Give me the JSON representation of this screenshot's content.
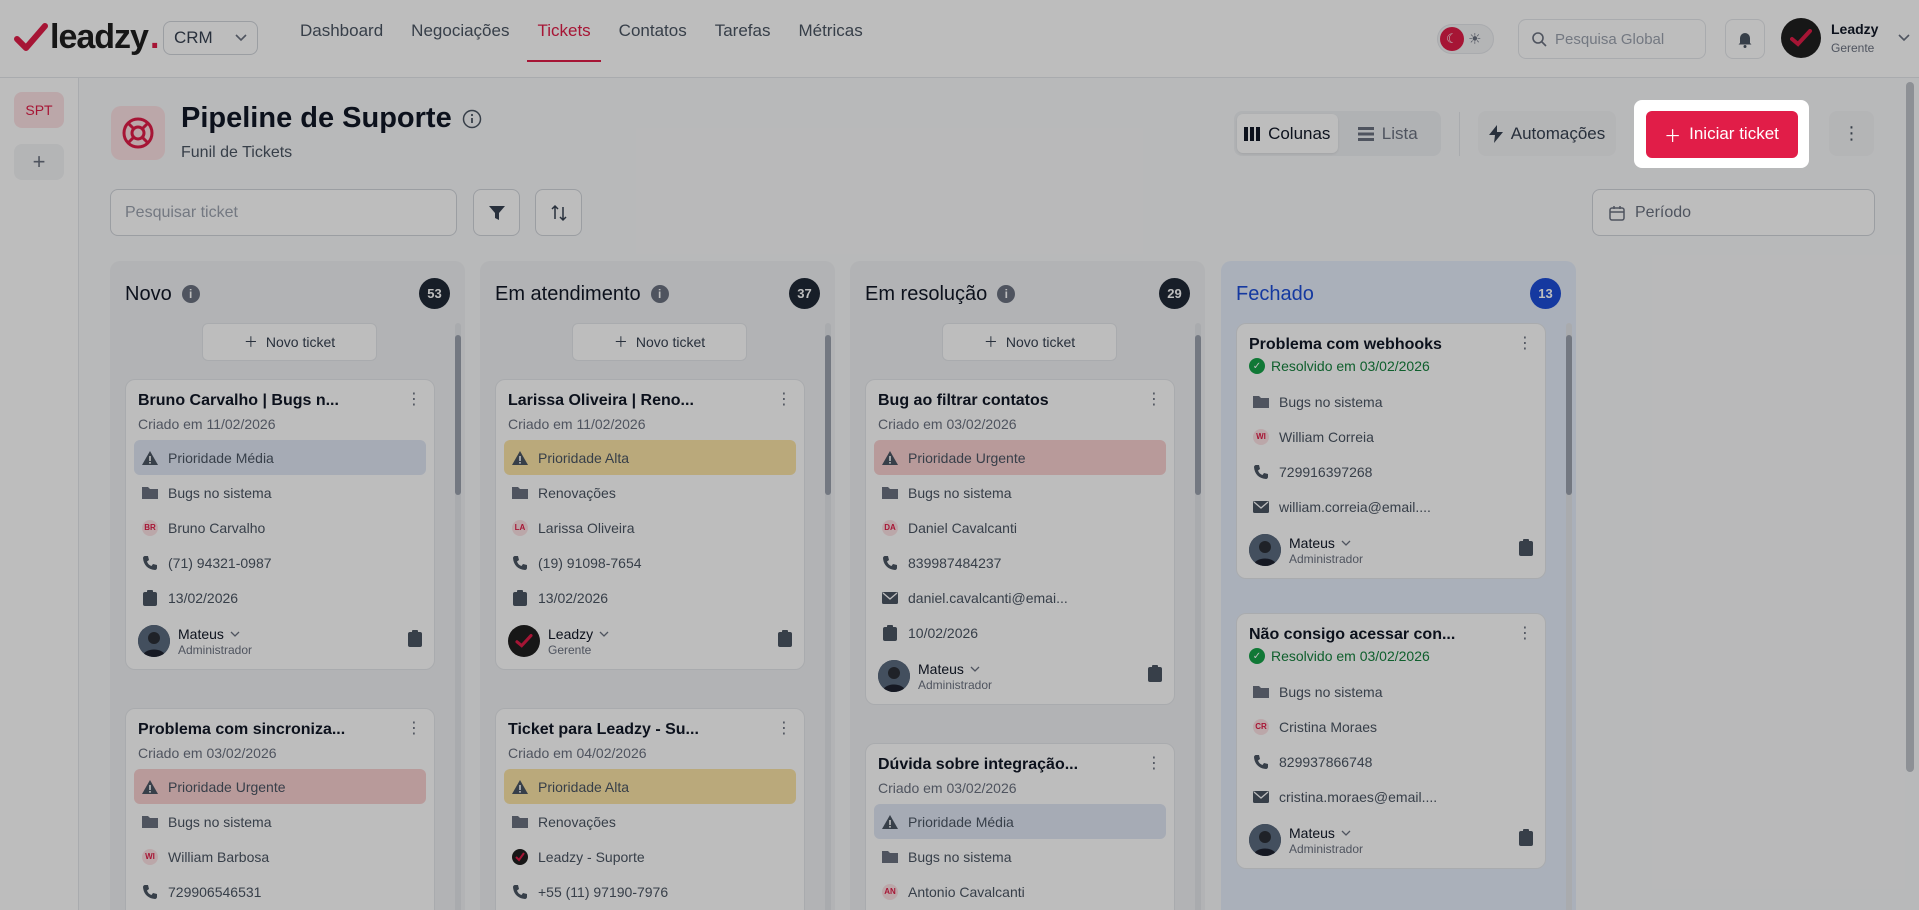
{
  "topbar": {
    "logo_text": "leadzy",
    "logo_dot": ".",
    "module_select": "CRM",
    "nav": [
      "Dashboard",
      "Negociações",
      "Tickets",
      "Contatos",
      "Tarefas",
      "Métricas"
    ],
    "active_nav": "Tickets",
    "search_placeholder": "Pesquisa Global",
    "user": {
      "name": "Leadzy",
      "role": "Gerente"
    }
  },
  "rail": {
    "pipeline_tag": "SPT",
    "add": "+"
  },
  "header": {
    "title": "Pipeline de Suporte",
    "subtitle": "Funil de Tickets",
    "view_columns": "Colunas",
    "view_list": "Lista",
    "automations": "Automações",
    "start_ticket": "Iniciar ticket",
    "search_placeholder": "Pesquisar ticket",
    "period": "Período"
  },
  "new_ticket_label": "Novo ticket",
  "columns": [
    {
      "title": "Novo",
      "count": "53",
      "cards": [
        {
          "title": "Bruno Carvalho | Bugs n...",
          "date": "Criado em 11/02/2026",
          "priority": "Prioridade Média",
          "category": "Bugs no sistema",
          "initials": "BR",
          "contact": "Bruno Carvalho",
          "phone": "(71) 94321-0987",
          "due": "13/02/2026",
          "assignee": "Mateus",
          "assignee_role": "Administrador"
        },
        {
          "title": "Problema com sincroniza...",
          "date": "Criado em 03/02/2026",
          "priority": "Prioridade Urgente",
          "category": "Bugs no sistema",
          "initials": "WI",
          "contact": "William Barbosa",
          "phone": "729906546531"
        }
      ]
    },
    {
      "title": "Em atendimento",
      "count": "37",
      "cards": [
        {
          "title": "Larissa Oliveira | Reno...",
          "date": "Criado em 11/02/2026",
          "priority": "Prioridade Alta",
          "category": "Renovações",
          "initials": "LA",
          "contact": "Larissa Oliveira",
          "phone": "(19) 91098-7654",
          "due": "13/02/2026",
          "assignee": "Leadzy",
          "assignee_role": "Gerente"
        },
        {
          "title": "Ticket para Leadzy - Su...",
          "date": "Criado em 04/02/2026",
          "priority": "Prioridade Alta",
          "category": "Renovações",
          "contact": "Leadzy - Suporte",
          "phone": "+55 (11) 97190-7976"
        }
      ]
    },
    {
      "title": "Em resolução",
      "count": "29",
      "cards": [
        {
          "title": "Bug ao filtrar contatos",
          "date": "Criado em 03/02/2026",
          "priority": "Prioridade Urgente",
          "category": "Bugs no sistema",
          "initials": "DA",
          "contact": "Daniel Cavalcanti",
          "phone": "839987484237",
          "email": "daniel.cavalcanti@emai...",
          "due": "10/02/2026",
          "assignee": "Mateus",
          "assignee_role": "Administrador"
        },
        {
          "title": "Dúvida sobre integração...",
          "date": "Criado em 03/02/2026",
          "priority": "Prioridade Média",
          "category": "Bugs no sistema",
          "initials": "AN",
          "contact": "Antonio Cavalcanti"
        }
      ]
    },
    {
      "title": "Fechado",
      "count": "13",
      "cards": [
        {
          "title": "Problema com webhooks",
          "resolved": "Resolvido em 03/02/2026",
          "category": "Bugs no sistema",
          "initials": "WI",
          "contact": "William Correia",
          "phone": "729916397268",
          "email": "william.correia@email....",
          "assignee": "Mateus",
          "assignee_role": "Administrador"
        },
        {
          "title": "Não consigo acessar con...",
          "resolved": "Resolvido em 03/02/2026",
          "category": "Bugs no sistema",
          "initials": "CR",
          "contact": "Cristina Moraes",
          "phone": "829937866748",
          "email": "cristina.moraes@email....",
          "assignee": "Mateus",
          "assignee_role": "Administrador"
        }
      ]
    }
  ],
  "colors": {
    "brand": "#e11d48",
    "closed_accent": "#1d4ed8",
    "priority_media": "#e0e7f5",
    "priority_alta": "#fbe5a6",
    "priority_urgente": "#f9d0d0"
  }
}
